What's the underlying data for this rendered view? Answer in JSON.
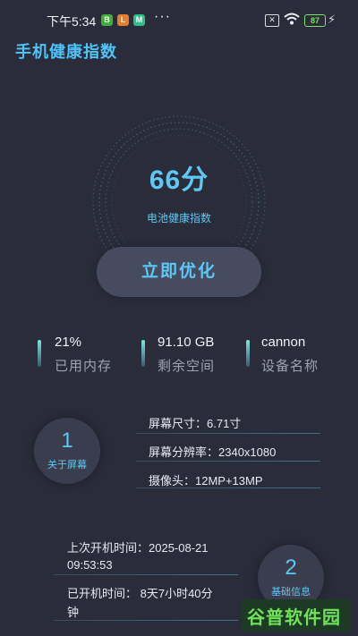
{
  "status_bar": {
    "time": "下午5:34",
    "app_badges": [
      {
        "letter": "B",
        "color": "#3fae3a"
      },
      {
        "letter": "L",
        "color": "#e77c2a"
      },
      {
        "letter": "M",
        "color": "#2cbf86"
      }
    ],
    "more": "···",
    "battery_level": "87"
  },
  "header": {
    "title": "手机健康指数"
  },
  "health": {
    "score": "66分",
    "label": "电池健康指数"
  },
  "optimize_button": "立即优化",
  "stats": [
    {
      "value": "21%",
      "label": "已用内存"
    },
    {
      "value": "91.10 GB",
      "label": "剩余空间"
    },
    {
      "value": "cannon",
      "label": "设备名称"
    }
  ],
  "screen_section": {
    "number": "1",
    "label": "关于屏幕",
    "lines": [
      "屏幕尺寸：6.71寸",
      "屏幕分辨率：2340x1080",
      "摄像头：12MP+13MP"
    ]
  },
  "basic_section": {
    "number": "2",
    "label": "基础信息",
    "boot_time_line1": "上次开机时间：2025-08-21",
    "boot_time_line2": "09:53:53",
    "uptime_line1": "已开机时间：  8天7小时40分",
    "uptime_line2": "钟"
  },
  "watermark": "谷普软件园",
  "colors": {
    "accent": "#5ec8f5",
    "background": "#2b2c3a"
  }
}
